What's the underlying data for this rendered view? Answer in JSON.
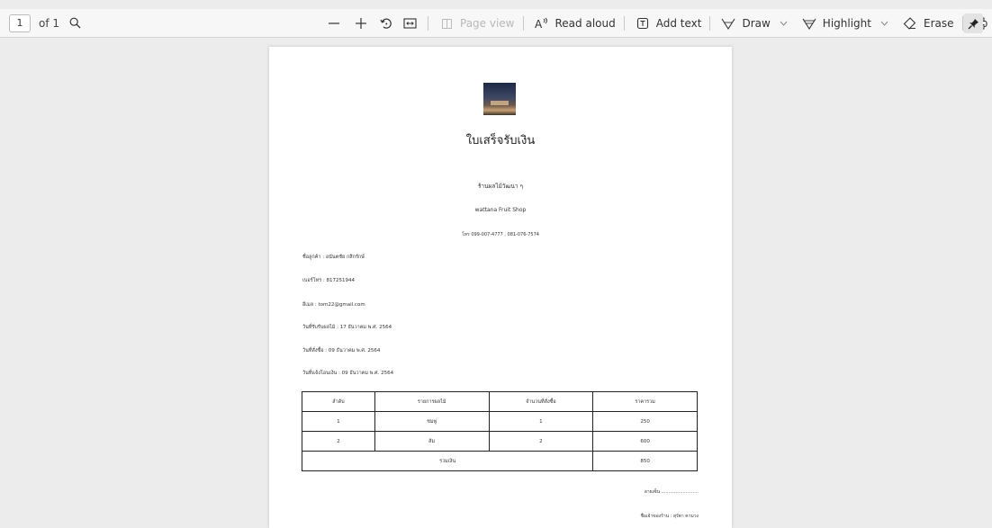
{
  "toolbar": {
    "page_number": "1",
    "page_of": "of 1",
    "page_view_label": "Page view",
    "read_aloud_label": "Read aloud",
    "add_text_label": "Add text",
    "draw_label": "Draw",
    "highlight_label": "Highlight",
    "erase_label": "Erase"
  },
  "document": {
    "title": "ใบเสร็จรับเงิน",
    "shop_name_thai": "ร้านผลไม้วัฒนา ๆ",
    "shop_name_en": "wattana Fruit Shop",
    "phone": "โทร 099-007-4777 , 081-076-7574",
    "customer_name": "ชื่อลูกค้า : อนันตชัย กสิกรักษ์",
    "customer_phone": "เบอร์โทร : 817251944",
    "email": "อีเมล : tom22@gmail.com",
    "receive_date": "วันที่รับรับผลไม้ : 17 ธันวาคม พ.ศ. 2564",
    "order_date": "วันที่สั่งซื้อ : 09 ธันวาคม พ.ศ. 2564",
    "payment_date": "วันที่แจ้งโอนเงิน : 09 ธันวาคม พ.ศ. 2564",
    "table": {
      "headers": [
        "ลำดับ",
        "รายการผลไม้",
        "จำนวนที่สั่งซื้อ",
        "ราคารวม"
      ],
      "rows": [
        [
          "1",
          "ชมพู่",
          "1",
          "250"
        ],
        [
          "2",
          "ส้ม",
          "2",
          "600"
        ]
      ],
      "total_label": "รวมเงิน",
      "total_value": "850"
    },
    "signature_line": "ลายเซ็น ..........................",
    "signer": "ชื่อเจ้าของร้าน : สุรัตา คามวง"
  }
}
